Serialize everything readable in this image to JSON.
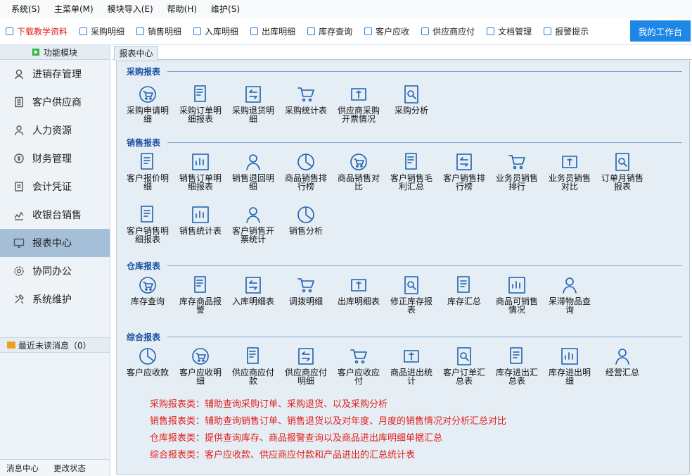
{
  "menu": [
    "系统(S)",
    "主菜单(M)",
    "模块导入(E)",
    "帮助(H)",
    "维护(S)"
  ],
  "toolbar": {
    "items": [
      "下载教学资料",
      "采购明细",
      "销售明细",
      "入库明细",
      "出库明细",
      "库存查询",
      "客户应收",
      "供应商应付",
      "文档管理",
      "报警提示"
    ],
    "workbench": "我的工作台",
    "accent_color": "#1e86e5",
    "highlight_color": "#e0201a"
  },
  "sidebar": {
    "header": "功能模块",
    "items": [
      {
        "label": "进销存管理",
        "icon": "inventory-icon"
      },
      {
        "label": "客户供应商",
        "icon": "document-icon"
      },
      {
        "label": "人力资源",
        "icon": "person-icon"
      },
      {
        "label": "财务管理",
        "icon": "coin-icon"
      },
      {
        "label": "会计凭证",
        "icon": "voucher-icon"
      },
      {
        "label": "收银台销售",
        "icon": "chart-line-icon"
      },
      {
        "label": "报表中心",
        "icon": "monitor-icon"
      },
      {
        "label": "协同办公",
        "icon": "gear-icon"
      },
      {
        "label": "系统维护",
        "icon": "tools-icon"
      }
    ],
    "active_index": 6,
    "messages": "最近未读消息（0）",
    "footer": [
      "消息中心",
      "更改状态"
    ]
  },
  "content": {
    "tab": "报表中心",
    "sections": [
      {
        "title": "采购报表",
        "items": [
          "采购申请明细",
          "采购订单明细报表",
          "采购退货明细",
          "采购统计表",
          "供应商采购开票情况",
          "采购分析"
        ]
      },
      {
        "title": "销售报表",
        "items": [
          "客户报价明细",
          "销售订单明细报表",
          "销售退回明细",
          "商品销售排行榜",
          "商品销售对比",
          "客户销售毛利汇总",
          "客户销售排行榜",
          "业务员销售排行",
          "业务员销售对比",
          "订单月销售报表",
          "客户销售明细报表",
          "销售统计表",
          "客户销售开票统计",
          "销售分析"
        ]
      },
      {
        "title": "仓库报表",
        "items": [
          "库存查询",
          "库存商品报警",
          "入库明细表",
          "调拨明细",
          "出库明细表",
          "修正库存报表",
          "库存汇总",
          "商品可销售情况",
          "呆滞物品查询"
        ]
      },
      {
        "title": "综合报表",
        "items": [
          "客户应收款",
          "客户应收明细",
          "供应商应付款",
          "供应商应付明细",
          "客户应收应付",
          "商品进出统计",
          "客户订单汇总表",
          "库存进出汇总表",
          "库存进出明细",
          "经营汇总"
        ]
      }
    ],
    "notes": [
      "采购报表类：辅助查询采购订单、采购退货、以及采购分析",
      "销售报表类：辅助查询销售订单、销售退货以及对年度、月度的销售情况对分析汇总对比",
      "仓库报表类：提供查询库存、商品报警查询以及商品进出库明细单据汇总",
      "综合报表类：客户应收款、供应商应付款和产品进出的汇总统计表"
    ]
  }
}
